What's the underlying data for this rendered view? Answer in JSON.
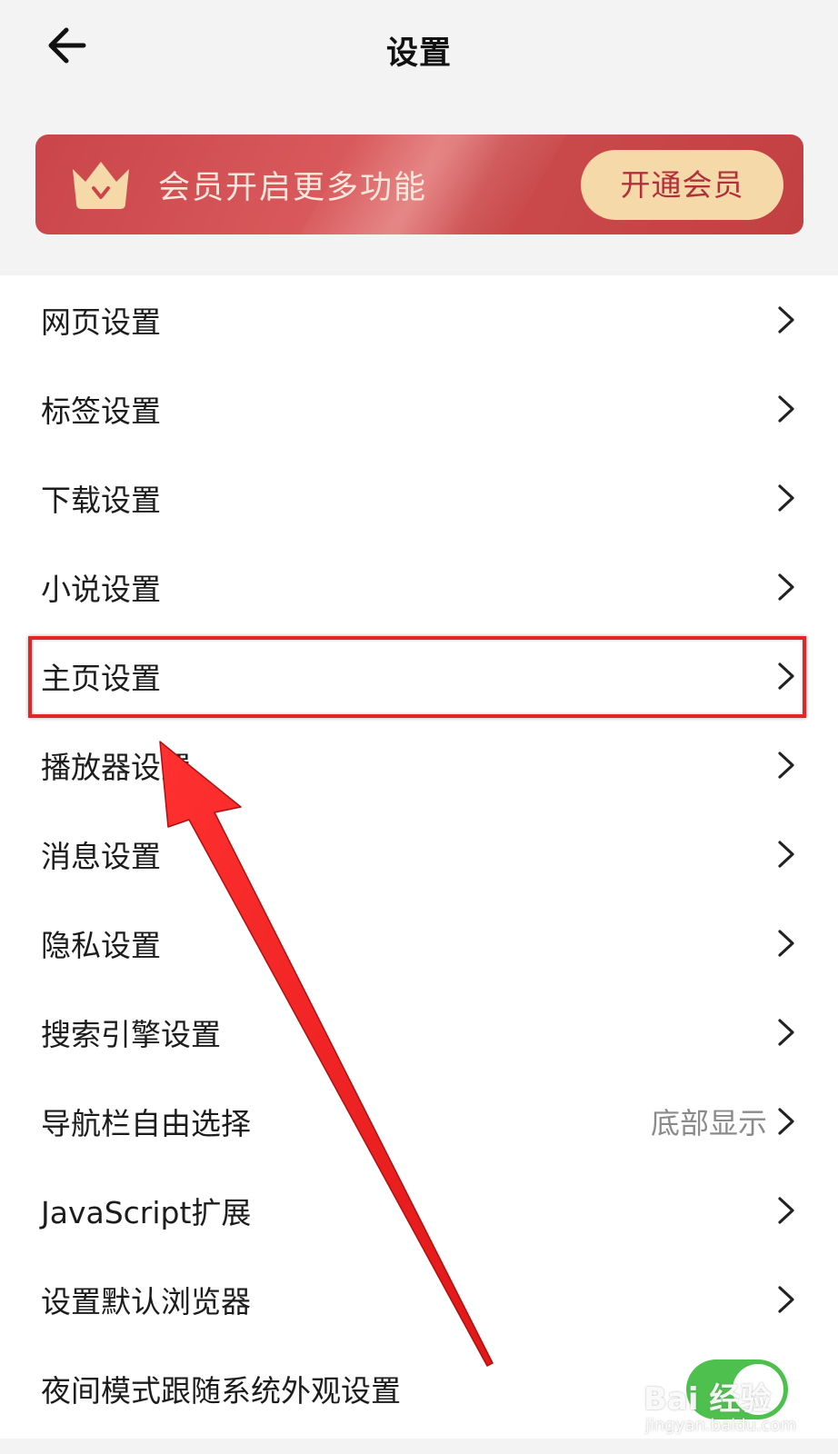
{
  "header": {
    "title": "设置",
    "back_icon": "arrow-left-icon"
  },
  "vip_banner": {
    "icon": "crown-icon",
    "text": "会员开启更多功能",
    "button_label": "开通会员",
    "colors": {
      "background": "#cb4a4b",
      "button_bg": "#f5d9a8",
      "button_text": "#b0313a",
      "crown": "#f5d9a8"
    }
  },
  "menu": {
    "items": [
      {
        "label": "网页设置"
      },
      {
        "label": "标签设置"
      },
      {
        "label": "下载设置"
      },
      {
        "label": "小说设置"
      },
      {
        "label": "主页设置",
        "highlighted": true
      },
      {
        "label": "播放器设置"
      },
      {
        "label": "消息设置"
      },
      {
        "label": "隐私设置"
      },
      {
        "label": "搜索引擎设置"
      },
      {
        "label": "导航栏自由选择",
        "value": "底部显示"
      },
      {
        "label": "JavaScript扩展"
      },
      {
        "label": "设置默认浏览器"
      },
      {
        "label": "夜间模式跟随系统外观设置",
        "toggle": true
      }
    ]
  },
  "annotation": {
    "color": "#e52222"
  },
  "toggle": {
    "state": "on",
    "color": "#4ec04e"
  },
  "watermark": {
    "main": "Bai 经验",
    "sub": "jingyan.baidu.com"
  }
}
